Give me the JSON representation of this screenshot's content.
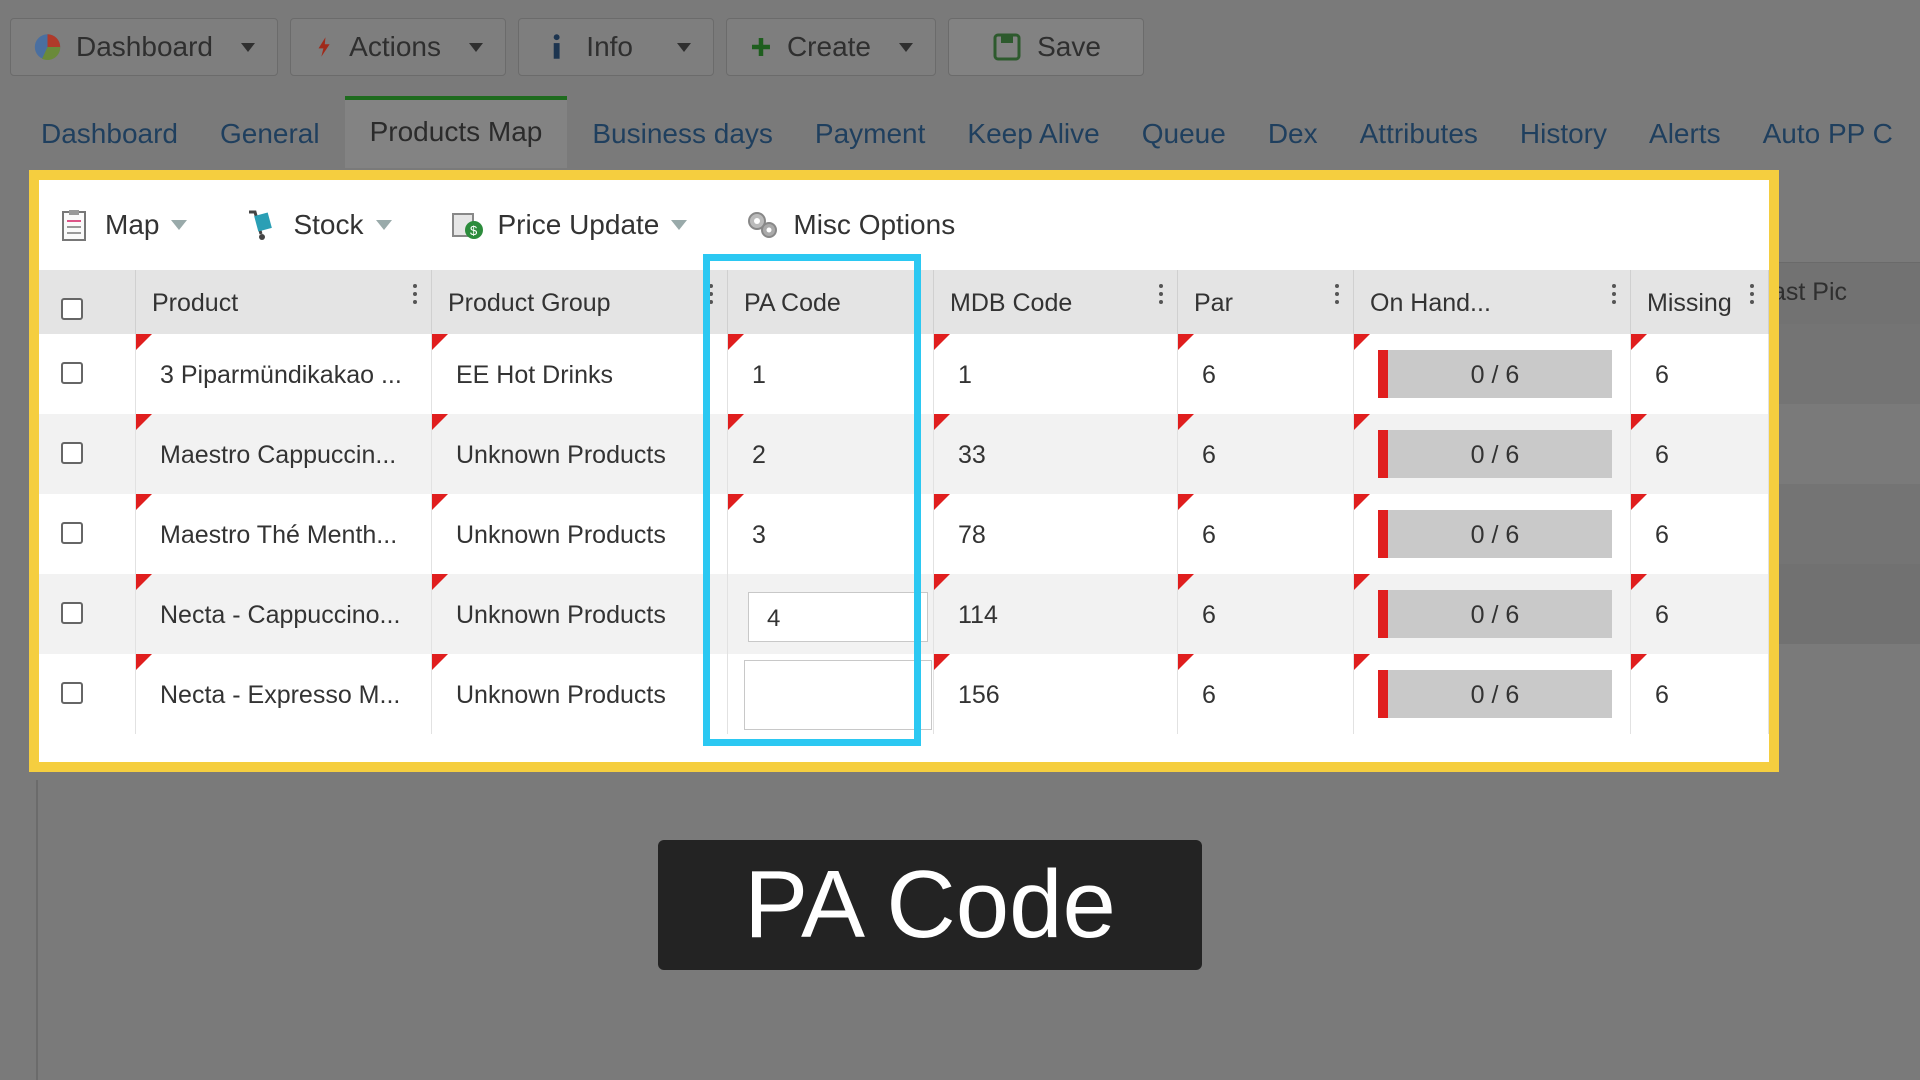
{
  "toolbar": {
    "buttons": [
      {
        "label": "Dashboard",
        "icon": "pie-chart-icon"
      },
      {
        "label": "Actions",
        "icon": "lightning-icon"
      },
      {
        "label": "Info",
        "icon": "info-icon"
      },
      {
        "label": "Create",
        "icon": "plus-icon"
      }
    ],
    "save_label": "Save"
  },
  "tabs": [
    {
      "label": "Dashboard"
    },
    {
      "label": "General"
    },
    {
      "label": "Products Map",
      "active": true
    },
    {
      "label": "Business days"
    },
    {
      "label": "Payment"
    },
    {
      "label": "Keep Alive"
    },
    {
      "label": "Queue"
    },
    {
      "label": "Dex"
    },
    {
      "label": "Attributes"
    },
    {
      "label": "History"
    },
    {
      "label": "Alerts"
    },
    {
      "label": "Auto PP C"
    }
  ],
  "panel_toolbar": {
    "map": "Map",
    "stock": "Stock",
    "price_update": "Price Update",
    "misc": "Misc Options"
  },
  "columns": {
    "product": "Product",
    "product_group": "Product Group",
    "pa_code": "PA Code",
    "mdb_code": "MDB Code",
    "par": "Par",
    "on_hand": "On Hand...",
    "missing": "Missing",
    "last_pic": "ast Pic"
  },
  "rows": [
    {
      "product": "3 Piparmündikakao ...",
      "group": "EE Hot Drinks",
      "pa_code": "1",
      "mdb": "1",
      "par": "6",
      "on_hand": "0 / 6",
      "missing": "6"
    },
    {
      "product": "Maestro Cappuccin...",
      "group": "Unknown Products",
      "pa_code": "2",
      "mdb": "33",
      "par": "6",
      "on_hand": "0 / 6",
      "missing": "6"
    },
    {
      "product": "Maestro Thé Menth...",
      "group": "Unknown Products",
      "pa_code": "3",
      "mdb": "78",
      "par": "6",
      "on_hand": "0 / 6",
      "missing": "6"
    },
    {
      "product": "Necta - Cappuccino...",
      "group": "Unknown Products",
      "pa_code": "4",
      "mdb": "114",
      "par": "6",
      "on_hand": "0 / 6",
      "missing": "6"
    },
    {
      "product": "Necta - Expresso M...",
      "group": "Unknown Products",
      "pa_code": "",
      "mdb": "156",
      "par": "6",
      "on_hand": "0 / 6",
      "missing": "6"
    }
  ],
  "caption": "PA Code",
  "colors": {
    "highlight_panel": "#f5ce3f",
    "highlight_column": "#2bc8f2",
    "flag": "#e01e1e"
  }
}
